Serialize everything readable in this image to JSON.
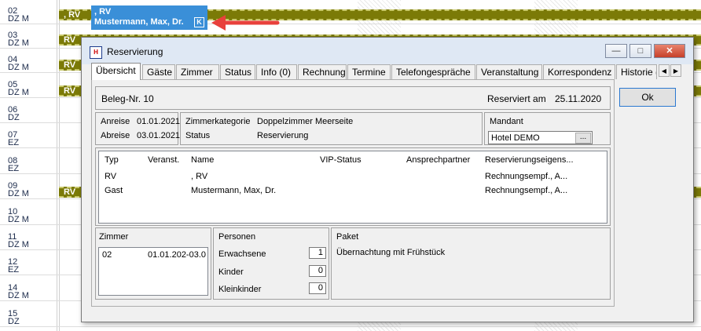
{
  "rows": [
    {
      "num": "02",
      "type": "DZ M"
    },
    {
      "num": "03",
      "type": "DZ M"
    },
    {
      "num": "04",
      "type": "DZ M"
    },
    {
      "num": "05",
      "type": "DZ M"
    },
    {
      "num": "06",
      "type": "DZ"
    },
    {
      "num": "07",
      "type": "EZ"
    },
    {
      "num": "08",
      "type": "EZ"
    },
    {
      "num": "09",
      "type": "DZ M"
    },
    {
      "num": "10",
      "type": "DZ M"
    },
    {
      "num": "11",
      "type": "DZ M"
    },
    {
      "num": "12",
      "type": "EZ"
    },
    {
      "num": "14",
      "type": "DZ M"
    },
    {
      "num": "15",
      "type": "DZ"
    }
  ],
  "bars": [
    ", RV",
    "RV",
    "RV",
    "RV",
    "RV"
  ],
  "selected_booking": {
    "line1": ", RV",
    "line2": "Mustermann, Max, Dr.",
    "badge": "K"
  },
  "dialog": {
    "title": "Reservierung",
    "minimize": "—",
    "maximize": "□",
    "close": "✕",
    "tabs": [
      "Übersicht",
      "Gäste",
      "Zimmer",
      "Status",
      "Info (0)",
      "Rechnung",
      "Termine",
      "Telefongespräche",
      "Veranstaltung",
      "Korrespondenz",
      "Historie ("
    ],
    "tab_prev": "◀",
    "tab_next": "▶",
    "ok": "Ok",
    "beleg": "Beleg-Nr. 10",
    "reserviert_label": "Reserviert am",
    "reserviert_date": "25.11.2020",
    "anreise_label": "Anreise",
    "anreise_date": "01.01.2021",
    "abreise_label": "Abreise",
    "abreise_date": "03.01.2021",
    "zimmerkategorie_label": "Zimmerkategorie",
    "zimmerkategorie_value": "Doppelzimmer Meerseite",
    "status_label": "Status",
    "status_value": "Reservierung",
    "mandant_label": "Mandant",
    "mandant_value": "Hotel DEMO",
    "mandant_btn": "...",
    "guest_headers": [
      "Typ",
      "Veranst.",
      "Name",
      "VIP-Status",
      "Ansprechpartner",
      "Reservierungseigens..."
    ],
    "guest_rows": [
      {
        "typ": "RV",
        "veranst": "",
        "name": ", RV",
        "vip": "",
        "ansprech": "",
        "reserv": "Rechnungsempf., A..."
      },
      {
        "typ": "Gast",
        "veranst": "",
        "name": "Mustermann, Max, Dr.",
        "vip": "",
        "ansprech": "",
        "reserv": "Rechnungsempf., A..."
      }
    ],
    "zimmer_label": "Zimmer",
    "zimmer_entry": {
      "room": "02",
      "date": "01.01.202-03.0"
    },
    "personen_label": "Personen",
    "erwachsene_label": "Erwachsene",
    "erwachsene_value": "1",
    "kinder_label": "Kinder",
    "kinder_value": "0",
    "kleinkinder_label": "Kleinkinder",
    "kleinkinder_value": "0",
    "paket_label": "Paket",
    "paket_value": "Übernachtung mit Frühstück"
  },
  "colors": {
    "bar": "#7b7a07",
    "selection": "#3a8fd8",
    "arrow": "#e8413c"
  }
}
